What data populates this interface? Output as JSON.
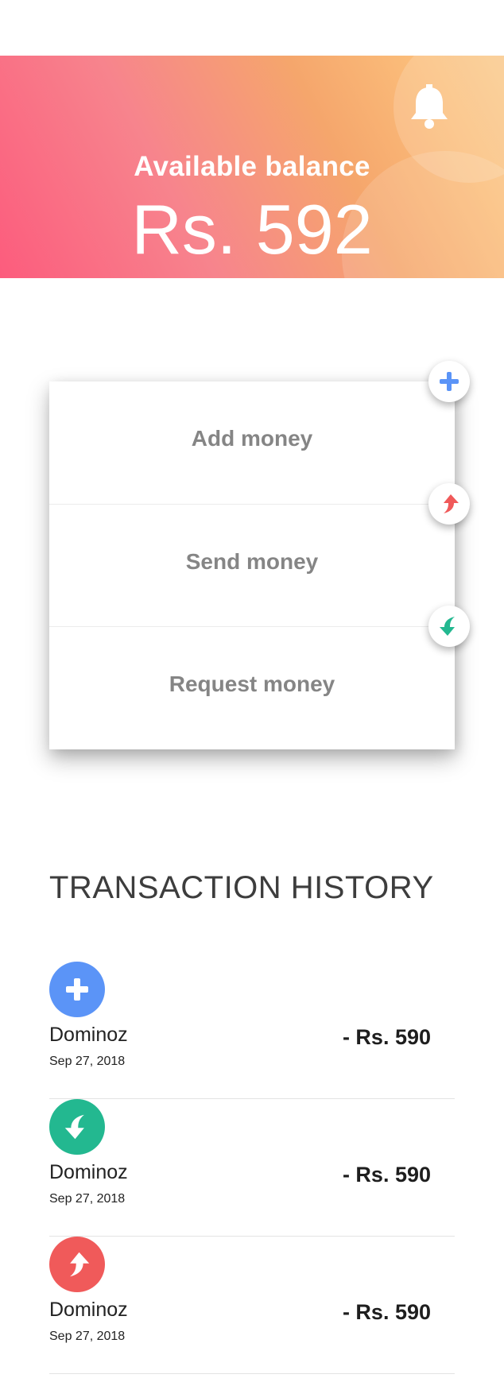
{
  "balance": {
    "label": "Available balance",
    "amount": "Rs. 592"
  },
  "icons": {
    "bell": "bell-icon",
    "add": "plus-icon",
    "send": "arrow-up-icon",
    "request": "arrow-down-icon"
  },
  "colors": {
    "banner_start": "#fc5c7d",
    "banner_end": "#fac98a",
    "add": "#5b94f7",
    "send": "#f05a5a",
    "request": "#23b890"
  },
  "actions": [
    {
      "label": "Add money"
    },
    {
      "label": "Send money"
    },
    {
      "label": "Request money"
    }
  ],
  "history": {
    "title": "TRANSACTION HISTORY",
    "items": [
      {
        "type": "add",
        "name": "Dominoz",
        "date": "Sep 27, 2018",
        "amount": "- Rs. 590"
      },
      {
        "type": "request",
        "name": "Dominoz",
        "date": "Sep 27, 2018",
        "amount": "- Rs. 590"
      },
      {
        "type": "send",
        "name": "Dominoz",
        "date": "Sep 27, 2018",
        "amount": "- Rs. 590"
      }
    ]
  }
}
